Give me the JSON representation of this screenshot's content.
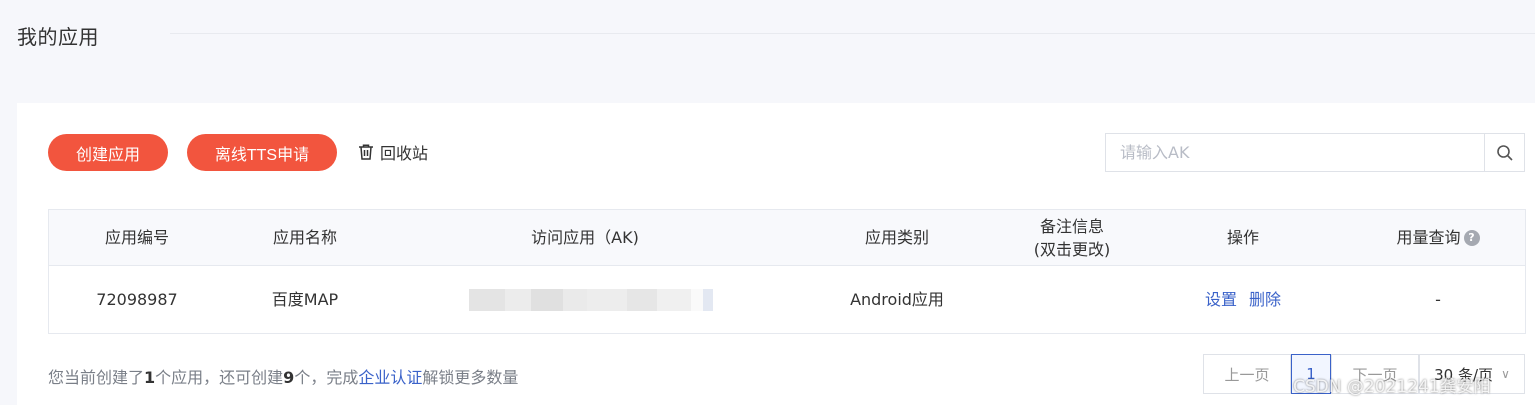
{
  "page": {
    "title": "我的应用"
  },
  "toolbar": {
    "create_label": "创建应用",
    "tts_label": "离线TTS申请",
    "recycle_label": "回收站",
    "search_placeholder": "请输入AK",
    "search_icon": "search-icon"
  },
  "table": {
    "headers": {
      "id": "应用编号",
      "name": "应用名称",
      "ak": "访问应用（AK)",
      "category": "应用类别",
      "remark_line1": "备注信息",
      "remark_line2": "(双击更改)",
      "actions": "操作",
      "usage": "用量查询"
    },
    "rows": [
      {
        "id": "72098987",
        "name": "百度MAP",
        "ak": "",
        "category": "Android应用",
        "remark": "",
        "settings": "设置",
        "delete": "删除",
        "usage": "-"
      }
    ]
  },
  "footer": {
    "prefix": "您当前创建了",
    "created": "1",
    "mid": "个应用，还可创建",
    "remaining": "9",
    "suffix1": "个，完成",
    "link": "企业认证",
    "suffix2": "解锁更多数量"
  },
  "pagination": {
    "prev": "上一页",
    "current": "1",
    "next": "下一页",
    "page_size": "30 条/页"
  },
  "watermark": "CSDN @2021241龚安阳",
  "colors": {
    "accent": "#f2553e",
    "link": "#3a62c9"
  }
}
